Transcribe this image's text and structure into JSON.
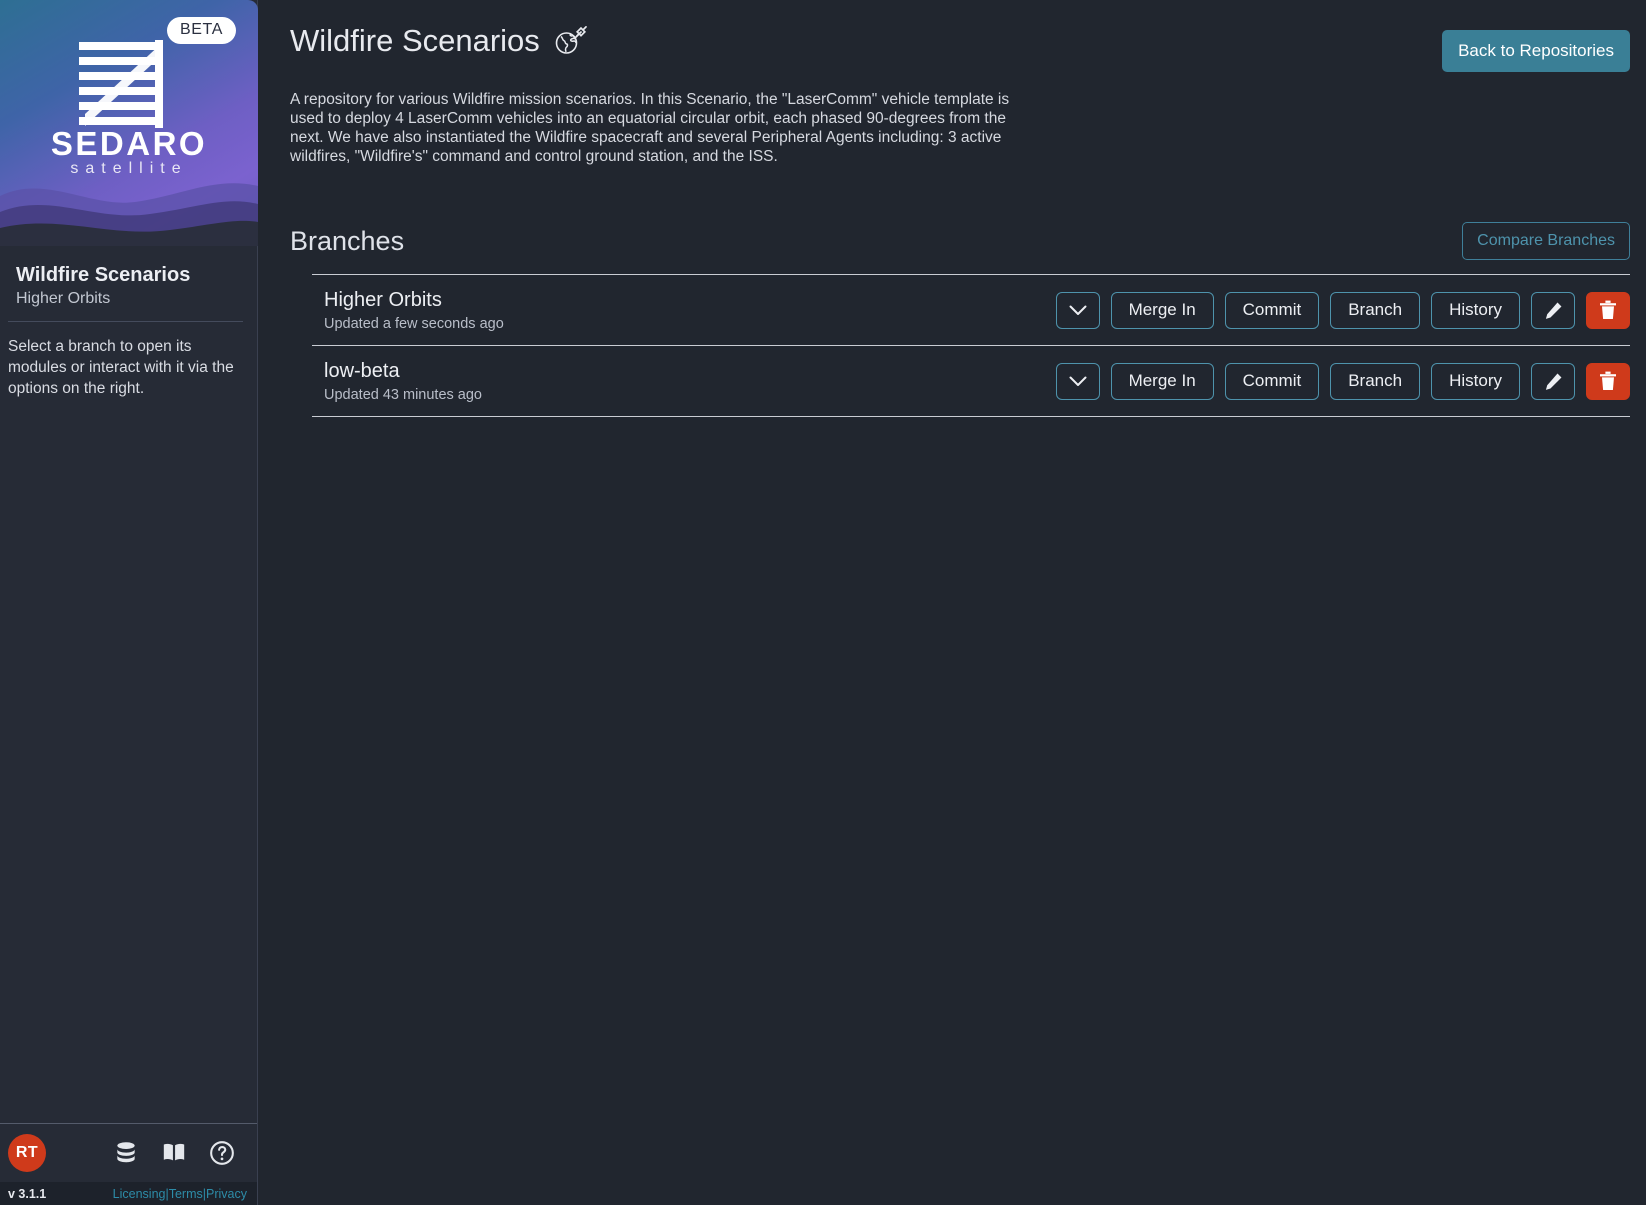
{
  "sidebar": {
    "brand": {
      "badge": "BETA",
      "name": "SEDARO",
      "tagline": "satellite",
      "logo_icon": "sedaro-logo-icon"
    },
    "repo_title": "Wildfire Scenarios",
    "repo_branch": "Higher Orbits",
    "hint": "Select a branch to open its modules or interact with it via the options on the right.",
    "avatar_initials": "RT",
    "icons": [
      {
        "name": "database-icon",
        "label": "Database"
      },
      {
        "name": "book-icon",
        "label": "Documentation"
      },
      {
        "name": "help-circle-icon",
        "label": "Help"
      }
    ],
    "version": "v 3.1.1",
    "legal": {
      "licensing": "Licensing",
      "terms": "Terms",
      "privacy": "Privacy",
      "separator": "|"
    }
  },
  "header": {
    "title": "Wildfire Scenarios",
    "title_icon": "globe-satellite-icon",
    "back_button": "Back to Repositories",
    "description": "A repository for various Wildfire mission scenarios. In this Scenario, the \"LaserComm\" vehicle template is used to deploy 4 LaserComm vehicles into an equatorial circular orbit, each phased 90-degrees from the next. We have also instantiated the Wildfire spacecraft and several Peripheral Agents including: 3 active wildfires, \"Wildfire's\" command and control ground station, and the ISS."
  },
  "branches_section": {
    "title": "Branches",
    "compare_button": "Compare Branches",
    "action_labels": {
      "expand": "",
      "merge_in": "Merge In",
      "commit": "Commit",
      "branch": "Branch",
      "history": "History",
      "edit": "",
      "delete": ""
    },
    "rows": [
      {
        "name": "Higher Orbits",
        "updated": "Updated a few seconds ago"
      },
      {
        "name": "low-beta",
        "updated": "Updated 43 minutes ago"
      }
    ]
  },
  "colors": {
    "accent_teal": "#4e93ac",
    "back_button_bg": "#3a7f96",
    "danger_red": "#cf3a1b",
    "app_bg": "#21262f",
    "sidebar_bg": "#262b36",
    "link_teal": "#2d8ca8"
  }
}
